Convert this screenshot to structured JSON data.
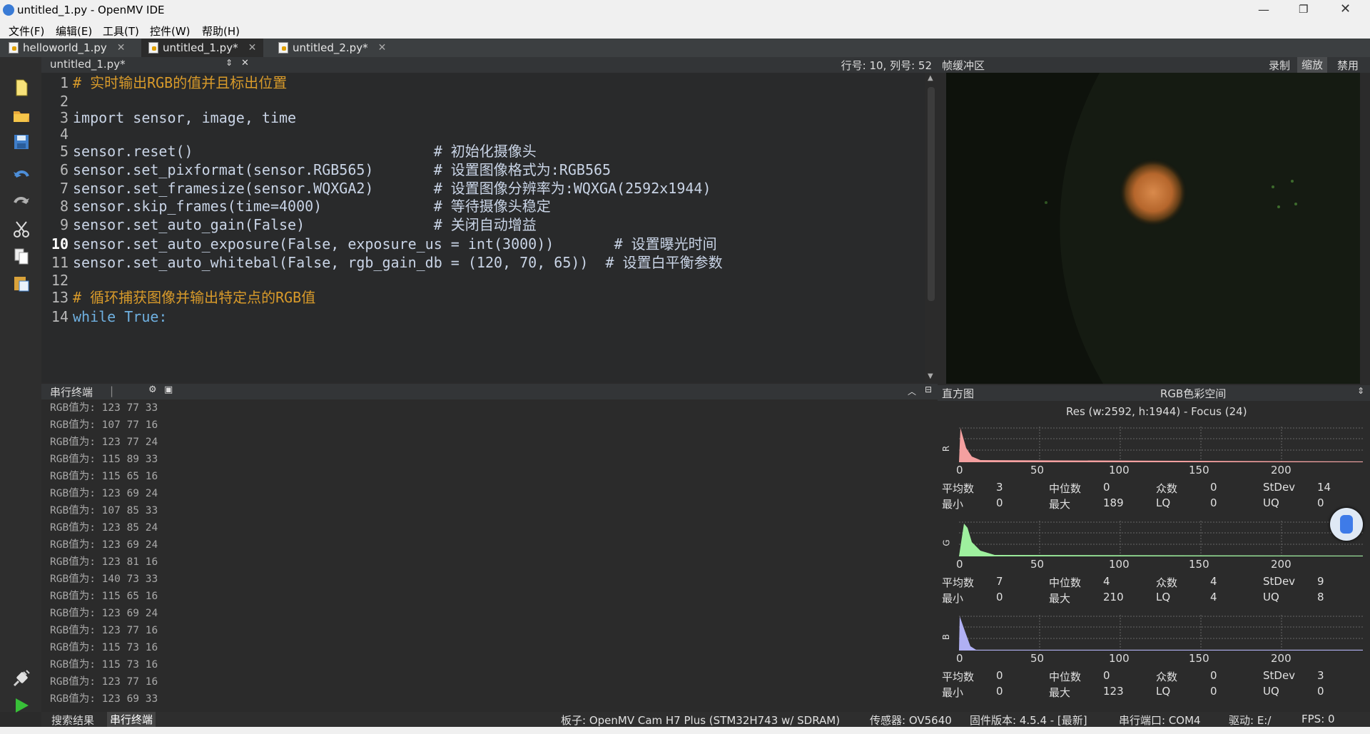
{
  "window": {
    "title": "untitled_1.py - OpenMV IDE"
  },
  "menu": [
    "文件(F)",
    "编辑(E)",
    "工具(T)",
    "控件(W)",
    "帮助(H)"
  ],
  "file_tabs": [
    {
      "label": "helloworld_1.py"
    },
    {
      "label": "untitled_1.py*"
    },
    {
      "label": "untitled_2.py*"
    }
  ],
  "editor": {
    "doc_selector": "untitled_1.py*",
    "cursor_position": "行号: 10, 列号: 52",
    "current_line": 10,
    "lines": [
      {
        "n": "1",
        "text": "# 实时输出RGB的值并且标出位置"
      },
      {
        "n": "2",
        "text": ""
      },
      {
        "n": "3",
        "text": "import sensor, image, time"
      },
      {
        "n": "4",
        "text": ""
      },
      {
        "n": "5",
        "text": "sensor.reset()                            # 初始化摄像头"
      },
      {
        "n": "6",
        "text": "sensor.set_pixformat(sensor.RGB565)       # 设置图像格式为:RGB565"
      },
      {
        "n": "7",
        "text": "sensor.set_framesize(sensor.WQXGA2)       # 设置图像分辨率为:WQXGA(2592x1944)"
      },
      {
        "n": "8",
        "text": "sensor.skip_frames(time=4000)             # 等待摄像头稳定"
      },
      {
        "n": "9",
        "text": "sensor.set_auto_gain(False)               # 关闭自动增益"
      },
      {
        "n": "10",
        "text": "sensor.set_auto_exposure(False, exposure_us = int(3000))       # 设置曝光时间"
      },
      {
        "n": "11",
        "text": "sensor.set_auto_whitebal(False, rgb_gain_db = (120, 70, 65))  # 设置白平衡参数"
      },
      {
        "n": "12",
        "text": ""
      },
      {
        "n": "13",
        "text": "# 循环捕获图像并输出特定点的RGB值"
      },
      {
        "n": "14",
        "text": "while True:"
      }
    ]
  },
  "framebuffer": {
    "title": "帧缓冲区",
    "buttons": [
      "录制",
      "缩放",
      "禁用"
    ]
  },
  "terminal": {
    "title": "串行终端",
    "lines": [
      "RGB值为: 123 77 33",
      "RGB值为: 107 77 16",
      "RGB值为: 123 77 24",
      "RGB值为: 115 89 33",
      "RGB值为: 115 65 16",
      "RGB值为: 123 69 24",
      "RGB值为: 107 85 33",
      "RGB值为: 123 85 24",
      "RGB值为: 123 69 24",
      "RGB值为: 123 81 16",
      "RGB值为: 140 73 33",
      "RGB值为: 115 65 16",
      "RGB值为: 123 69 24",
      "RGB值为: 123 77 16",
      "RGB值为: 115 73 16",
      "RGB值为: 115 73 16",
      "RGB值为: 123 77 16",
      "RGB值为: 123 69 33"
    ]
  },
  "histogram": {
    "title": "直方图",
    "colorspace": "RGB色彩空间",
    "resolution": "Res (w:2592, h:1944) - Focus (24)",
    "axis_ticks": [
      "0",
      "50",
      "100",
      "150",
      "200"
    ],
    "labels": {
      "mean": "平均数",
      "median": "中位数",
      "mode": "众数",
      "stdev": "StDev",
      "min": "最小",
      "max": "最大",
      "lq": "LQ",
      "uq": "UQ"
    },
    "channels": [
      {
        "name": "R",
        "color": "#f4a0a0",
        "mean": "3",
        "median": "0",
        "mode": "0",
        "stdev": "14",
        "min": "0",
        "max": "189",
        "lq": "0",
        "uq": "0"
      },
      {
        "name": "G",
        "color": "#9ef09e",
        "mean": "7",
        "median": "4",
        "mode": "4",
        "stdev": "9",
        "min": "0",
        "max": "210",
        "lq": "4",
        "uq": "8"
      },
      {
        "name": "B",
        "color": "#b0b0f4",
        "mean": "0",
        "median": "0",
        "mode": "0",
        "stdev": "3",
        "min": "0",
        "max": "123",
        "lq": "0",
        "uq": "0"
      }
    ]
  },
  "bottom_tabs": [
    "搜索结果",
    "串行终端"
  ],
  "status": {
    "board": "板子: OpenMV Cam H7 Plus (STM32H743 w/ SDRAM)",
    "sensor": "传感器: OV5640",
    "firmware": "固件版本: 4.5.4 - [最新]",
    "port": "串行端口: COM4",
    "drive": "驱动: E:/",
    "fps": "FPS: 0"
  }
}
